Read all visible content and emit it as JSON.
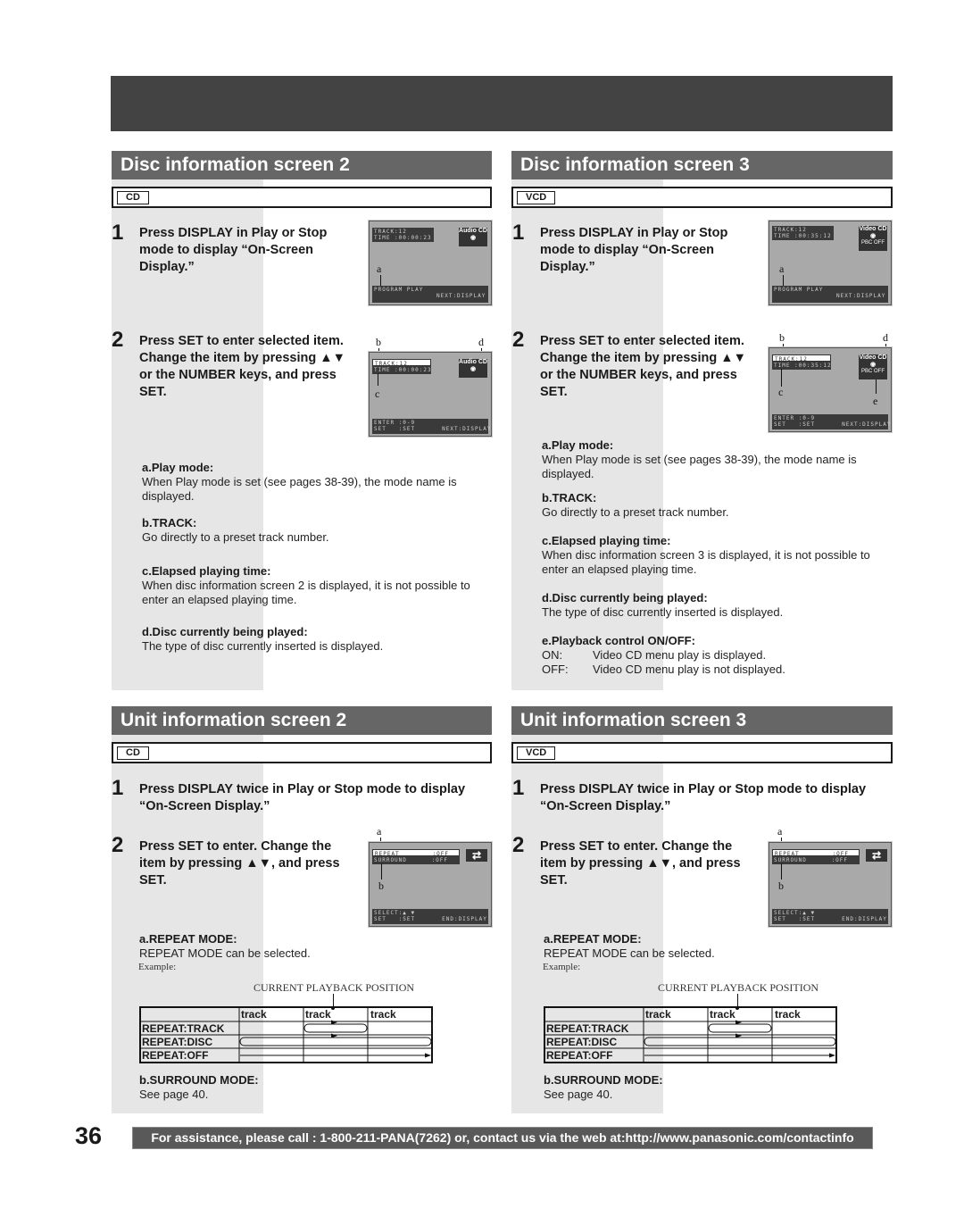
{
  "page_number": "36",
  "footer": {
    "text": "For assistance, please call : 1-800-211-PANA(7262) or, contact us via the web at:http://www.panasonic.com/contactinfo"
  },
  "sections": {
    "disc2": {
      "title": "Disc information screen 2",
      "disc_type": "CD",
      "steps": [
        {
          "num": "1",
          "text": "Press DISPLAY in Play or Stop mode to display “On-Screen Display.”"
        },
        {
          "num": "2",
          "text": "Press SET to enter selected item. Change the item by pressing ▲▼ or the NUMBER keys, and press SET."
        }
      ],
      "osd1": {
        "line1": "TRACK:12",
        "line2": "TIME :00:00:23",
        "bottom1": "PROGRAM PLAY",
        "bottom2": "NEXT:DISPLAY",
        "logo": "Audio CD",
        "callout_a": "a"
      },
      "osd2": {
        "line1": "TRACK:12",
        "line2": "TIME :00:00:23",
        "bottom1": "ENTER :0-9",
        "bottom2": "SET   :SET",
        "bottom3": "NEXT:DISPLAY",
        "logo": "Audio CD",
        "callout_b": "b",
        "callout_c": "c",
        "callout_d": "d"
      },
      "descriptions": [
        {
          "title": "a.Play mode:",
          "text": "When Play mode is set (see pages 38-39), the mode name is displayed."
        },
        {
          "title": "b.TRACK:",
          "text": "Go directly to a preset track number."
        },
        {
          "title": "c.Elapsed playing time:",
          "text": "When disc information screen 2 is displayed, it is not possible to enter an elapsed playing time."
        },
        {
          "title": "d.Disc currently being played:",
          "text": "The type of disc currently inserted is displayed."
        }
      ]
    },
    "disc3": {
      "title": "Disc information screen 3",
      "disc_type": "VCD",
      "steps": [
        {
          "num": "1",
          "text": "Press DISPLAY in Play or Stop mode to display “On-Screen Display.”"
        },
        {
          "num": "2",
          "text": "Press SET to enter selected item. Change the item by pressing ▲▼ or the NUMBER keys, and press SET."
        }
      ],
      "osd1": {
        "line1": "TRACK:12",
        "line2": "TIME :00:35:12",
        "bottom1": "PROGRAM PLAY",
        "bottom2": "NEXT:DISPLAY",
        "logo": "Video CD",
        "pbc": "PBC OFF",
        "callout_a": "a"
      },
      "osd2": {
        "line1": "TRACK:12",
        "line2": "TIME :00:35:12",
        "bottom1": "ENTER :0-9",
        "bottom2": "SET   :SET",
        "bottom3": "NEXT:DISPLAY",
        "logo": "Video CD",
        "pbc": "PBC OFF",
        "callout_b": "b",
        "callout_c": "c",
        "callout_d": "d",
        "callout_e": "e"
      },
      "descriptions": [
        {
          "title": "a.Play mode:",
          "text": "When Play mode is set (see pages 38-39), the mode name is displayed."
        },
        {
          "title": "b.TRACK:",
          "text": "Go directly to a preset track number."
        },
        {
          "title": "c.Elapsed playing time:",
          "text": "When disc information screen 3 is displayed, it is not possible to enter an elapsed playing time."
        },
        {
          "title": "d.Disc currently being played:",
          "text": "The type of disc currently inserted is displayed."
        },
        {
          "title": "e.Playback control ON/OFF:",
          "on_label": "ON:",
          "on_text": "Video CD menu play is displayed.",
          "off_label": "OFF:",
          "off_text": "Video CD menu play is not displayed."
        }
      ]
    },
    "unit2": {
      "title": "Unit information screen 2",
      "disc_type": "CD",
      "steps": [
        {
          "num": "1",
          "text": "Press DISPLAY twice in Play or Stop mode  to display “On-Screen Display.”"
        },
        {
          "num": "2",
          "text": "Press SET to enter. Change the item by pressing ▲▼, and press SET."
        }
      ],
      "osd": {
        "row1": "REPEAT        :OFF",
        "row2": "SURROUND      :OFF",
        "bottom1": "SELECT:▲ ▼",
        "bottom2": "SET   :SET",
        "bottom3": "END:DISPLAY",
        "callout_a": "a",
        "callout_b": "b"
      },
      "repeat_title": "a.REPEAT MODE:",
      "repeat_text": "REPEAT MODE can be selected.",
      "example_label": "Example:",
      "current_position_label": "CURRENT PLAYBACK POSITION",
      "table": {
        "headers": [
          "",
          "track",
          "track",
          "track"
        ],
        "rows": [
          "REPEAT:TRACK",
          "REPEAT:DISC",
          "REPEAT:OFF"
        ]
      },
      "surround_title": "b.SURROUND MODE:",
      "surround_text": "See page 40."
    },
    "unit3": {
      "title": "Unit information screen 3",
      "disc_type": "VCD",
      "steps": [
        {
          "num": "1",
          "text": "Press DISPLAY twice in Play or Stop mode  to display “On-Screen Display.”"
        },
        {
          "num": "2",
          "text": "Press SET to enter. Change the item by pressing ▲▼, and press SET."
        }
      ],
      "osd": {
        "row1": "REPEAT        :OFF",
        "row2": "SURROUND      :OFF",
        "bottom1": "SELECT:▲ ▼",
        "bottom2": "SET   :SET",
        "bottom3": "END:DISPLAY",
        "callout_a": "a",
        "callout_b": "b"
      },
      "repeat_title": "a.REPEAT MODE:",
      "repeat_text": "REPEAT MODE can be selected.",
      "example_label": "Example:",
      "current_position_label": "CURRENT PLAYBACK POSITION",
      "table": {
        "headers": [
          "",
          "track",
          "track",
          "track"
        ],
        "rows": [
          "REPEAT:TRACK",
          "REPEAT:DISC",
          "REPEAT:OFF"
        ]
      },
      "surround_title": "b.SURROUND MODE:",
      "surround_text": "See page 40."
    }
  }
}
